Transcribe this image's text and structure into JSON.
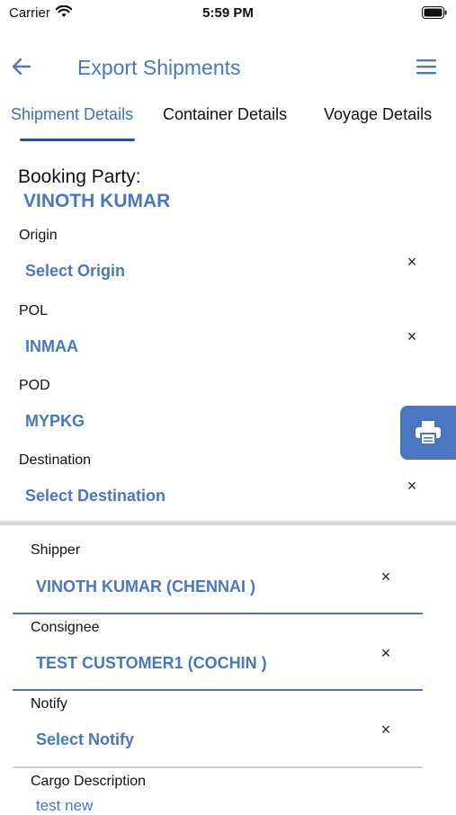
{
  "status_bar": {
    "carrier": "Carrier",
    "time": "5:59 PM"
  },
  "header": {
    "title": "Export Shipments",
    "back_icon": "arrow-left-icon",
    "menu_icon": "hamburger-menu-icon"
  },
  "tabs": [
    {
      "label": "Shipment Details",
      "active": true
    },
    {
      "label": "Container Details",
      "active": false
    },
    {
      "label": "Voyage Details",
      "active": false
    }
  ],
  "booking_party": {
    "label": "Booking Party:",
    "value": "VINOTH KUMAR"
  },
  "fields": {
    "origin": {
      "label": "Origin",
      "value": "Select Origin"
    },
    "pol": {
      "label": "POL",
      "value": "INMAA"
    },
    "pod": {
      "label": "POD",
      "value": "MYPKG"
    },
    "destination": {
      "label": "Destination",
      "value": "Select Destination"
    },
    "shipper": {
      "label": "Shipper",
      "value": "VINOTH KUMAR (CHENNAI )"
    },
    "consignee": {
      "label": "Consignee",
      "value": "TEST CUSTOMER1 (COCHIN )"
    },
    "notify": {
      "label": "Notify",
      "value": "Select Notify"
    },
    "cargo": {
      "label": "Cargo Description",
      "value": "test new"
    }
  },
  "icons": {
    "clear": "×",
    "print": "print-icon"
  },
  "colors": {
    "accent": "#4a77c1",
    "tab_indicator": "#2a4f8f",
    "divider": "#d9d9d9"
  }
}
